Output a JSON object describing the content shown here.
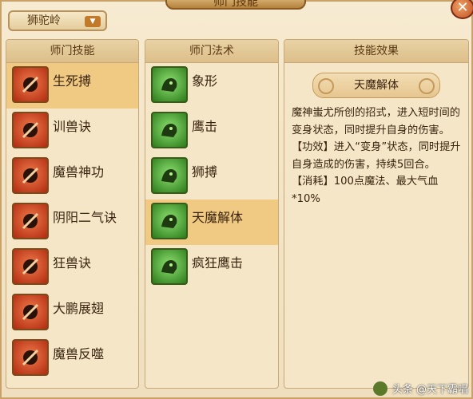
{
  "window": {
    "title": "师门技能",
    "close_label": "✕"
  },
  "school_dropdown": {
    "selected": "狮驼岭",
    "caret": "▼"
  },
  "skills_panel": {
    "header": "师门技能",
    "selected_index": 0,
    "items": [
      {
        "label": "生死搏",
        "icon": "skull-slash-icon"
      },
      {
        "label": "训兽诀",
        "icon": "whip-icon"
      },
      {
        "label": "魔兽神功",
        "icon": "demon-crown-icon"
      },
      {
        "label": "阴阳二气诀",
        "icon": "yinyang-totem-icon"
      },
      {
        "label": "狂兽诀",
        "icon": "beast-face-icon"
      },
      {
        "label": "大鹏展翅",
        "icon": "roc-wing-icon"
      },
      {
        "label": "魔兽反噬",
        "icon": "devour-beast-icon"
      }
    ]
  },
  "spells_panel": {
    "header": "师门法术",
    "selected_index": 3,
    "items": [
      {
        "label": "象形",
        "icon": "elephant-icon"
      },
      {
        "label": "鹰击",
        "icon": "eagle-strike-icon"
      },
      {
        "label": "狮搏",
        "icon": "lion-icon"
      },
      {
        "label": "天魔解体",
        "icon": "demon-transform-icon"
      },
      {
        "label": "疯狂鹰击",
        "icon": "frenzy-eagle-icon"
      }
    ]
  },
  "effect_panel": {
    "header": "技能效果",
    "skill_name": "天魔解体",
    "description": "魔神蚩尤所创的招式，进入短时间的变身状态，同时提升自身的伤害。",
    "effect_line": "【功效】进入“变身”状态，同时提升自身造成的伤害，持续5回合。",
    "cost_line": "【消耗】100点魔法、最大气血*10%"
  },
  "watermark": {
    "text": "头条 @天下霸唱"
  },
  "colors": {
    "frame_bg": "#f6ead0",
    "selected_row": "#f0c982",
    "skill_icon_bg": "#d0401a",
    "spell_icon_bg": "#5aa83a"
  }
}
